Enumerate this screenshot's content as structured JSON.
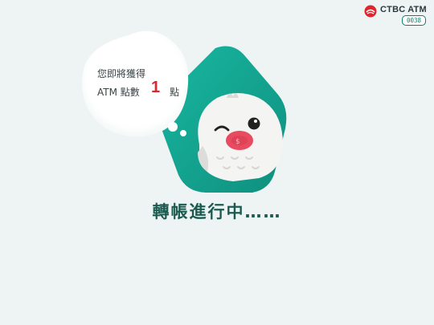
{
  "brand": {
    "name": "CTBC ATM",
    "code": "0038",
    "accent": "#0f7d6c",
    "logo_color": "#e0262c"
  },
  "bubble": {
    "line1": "您即將獲得",
    "line2_prefix": "ATM 點數",
    "points": "1",
    "unit": "點"
  },
  "status": {
    "message": "轉帳進行中……"
  },
  "colors": {
    "background": "#eef3f4",
    "panel": "#13a58f",
    "points": "#e0262c",
    "status": "#1b5b4f"
  },
  "icons": [
    "ctbc-logo-icon",
    "owl-mascot-icon",
    "thought-bubble-icon"
  ]
}
